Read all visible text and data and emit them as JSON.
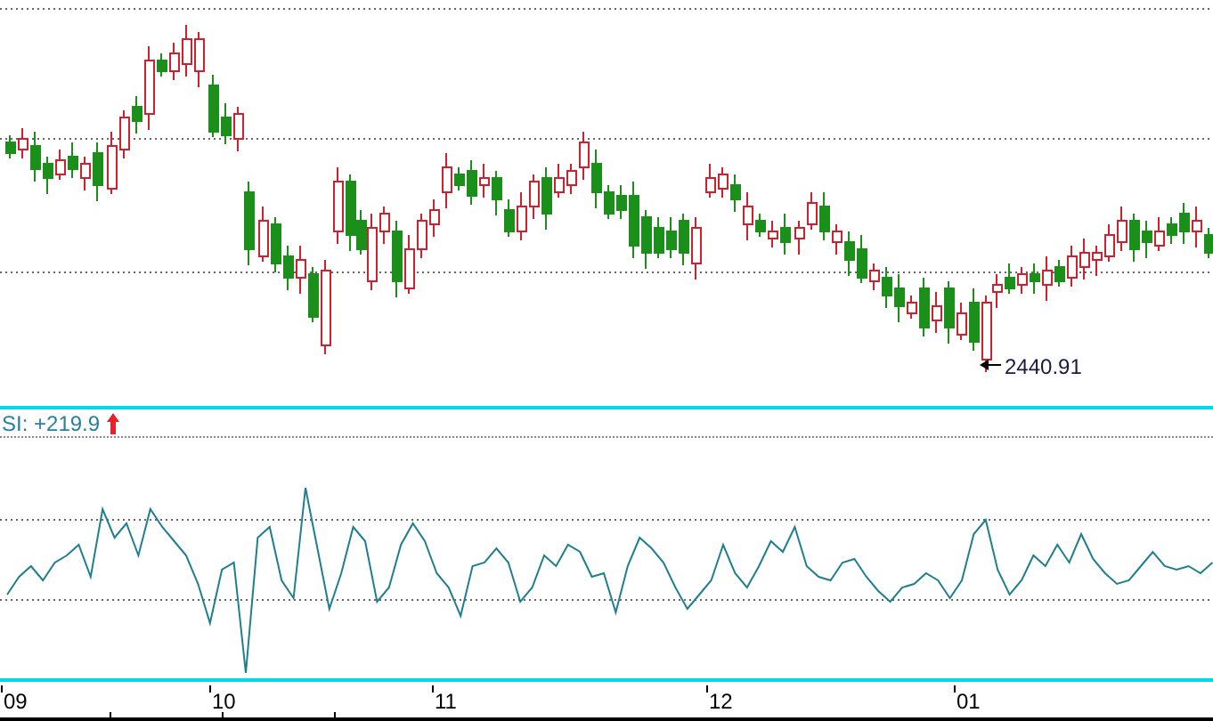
{
  "price_panel": {
    "low_label": "2440.91"
  },
  "indicator_panel": {
    "label": "SI: +219.9",
    "rising": true
  },
  "x_axis": {
    "labels": [
      "09",
      "10",
      "11",
      "12",
      "01"
    ]
  }
}
